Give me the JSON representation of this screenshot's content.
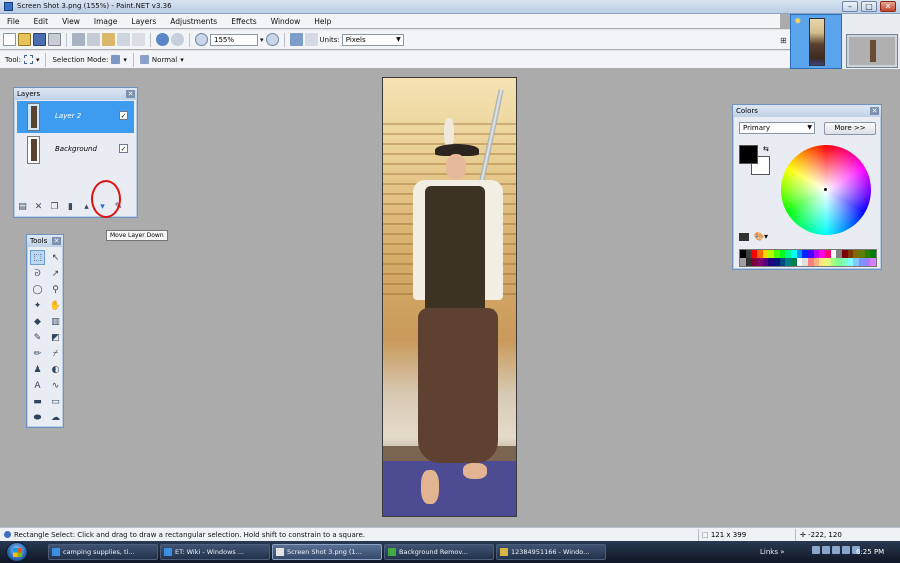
{
  "window": {
    "title": "Screen Shot 3.png (155%) - Paint.NET v3.36",
    "buttons": {
      "minimize": "–",
      "maximize": "□",
      "close": "✕"
    }
  },
  "menu": [
    "File",
    "Edit",
    "View",
    "Image",
    "Layers",
    "Adjustments",
    "Effects",
    "Window",
    "Help"
  ],
  "toolbar": {
    "zoom_value": "155%",
    "units_label": "Units:",
    "units_value": "Pixels"
  },
  "toolbar2": {
    "tool_label": "Tool:",
    "selection_mode_label": "Selection Mode:",
    "blend_mode": "Normal"
  },
  "layers_panel": {
    "title": "Layers",
    "items": [
      {
        "name": "Layer 2",
        "selected": true,
        "visible": true
      },
      {
        "name": "Background",
        "selected": false,
        "visible": true
      }
    ],
    "check_mark": "✓",
    "tooltip": "Move Layer Down"
  },
  "tools_panel": {
    "title": "Tools"
  },
  "colors_panel": {
    "title": "Colors",
    "mode": "Primary",
    "more_button": "More >>",
    "primary_color": "#000000",
    "secondary_color": "#ffffff",
    "palette_row1": [
      "#000000",
      "#404040",
      "#ff0000",
      "#ff6a00",
      "#ffd800",
      "#b6ff00",
      "#4cff00",
      "#00ff21",
      "#00ff90",
      "#00ffff",
      "#0094ff",
      "#0026ff",
      "#4800ff",
      "#b200ff",
      "#ff00dc",
      "#ff006e",
      "#ffffff",
      "#808080",
      "#7f0000",
      "#7f3300",
      "#7f6a00",
      "#5b7f00",
      "#267f00",
      "#007f0e"
    ],
    "palette_row2": [
      "#a0a0a0",
      "#303030",
      "#7f0037",
      "#7f006e",
      "#57007f",
      "#21007f",
      "#00137f",
      "#004a7f",
      "#007f7f",
      "#007f46",
      "#ffffff",
      "#e0e0e0",
      "#ff7f7f",
      "#ffb27f",
      "#ffe97f",
      "#daff7f",
      "#a5ff7f",
      "#7fff8e",
      "#7fffc5",
      "#7fffff",
      "#7fc9ff",
      "#7f92ff",
      "#a17fff",
      "#d67fff"
    ]
  },
  "status": {
    "message": "Rectangle Select: Click and drag to draw a rectangular selection. Hold shift to constrain to a square.",
    "size": "121 x 399",
    "coords": "-222, 120"
  },
  "taskbar": {
    "tasks": [
      {
        "label": "camping supplies, ti...",
        "active": false
      },
      {
        "label": "ET: Wiki - Windows ...",
        "active": false
      },
      {
        "label": "Screen Shot 3.png (1...",
        "active": true
      },
      {
        "label": "Background Remov...",
        "active": false
      },
      {
        "label": "12384951166 - Windo...",
        "active": false
      }
    ],
    "links_label": "Links",
    "clock": "6:25 PM"
  }
}
